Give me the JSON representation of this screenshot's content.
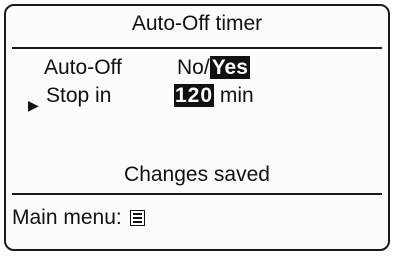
{
  "screen": {
    "title": "Auto-Off timer",
    "auto_off": {
      "label": "Auto-Off",
      "option_no": "No/",
      "option_yes": "Yes"
    },
    "stop_in": {
      "label": "Stop in",
      "value": "120",
      "unit": "min"
    },
    "status": "Changes saved",
    "footer": {
      "main_menu_label": "Main menu:",
      "icon": "menu-list-icon"
    }
  }
}
